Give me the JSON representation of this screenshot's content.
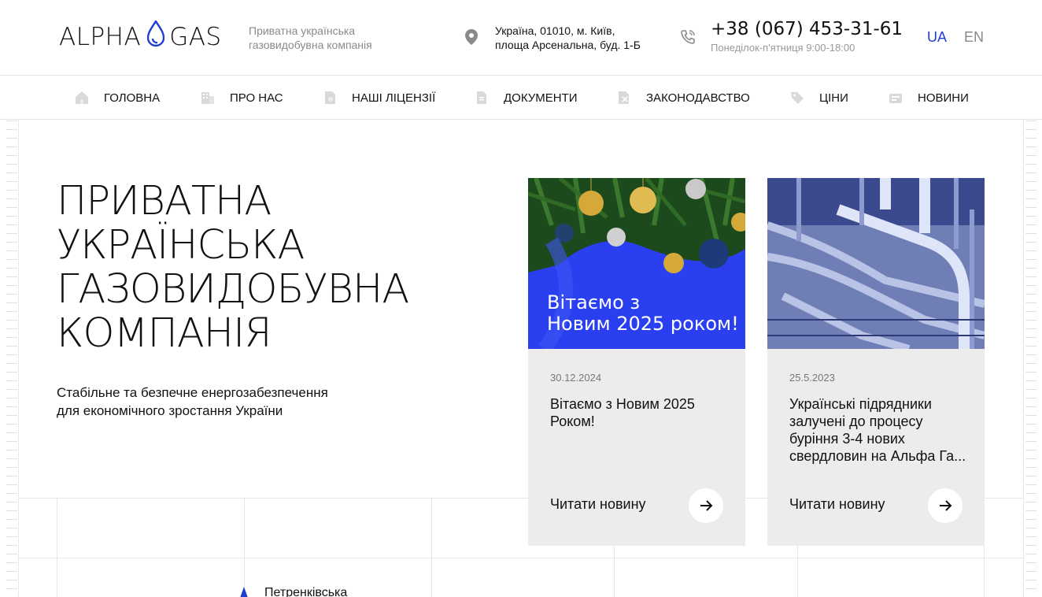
{
  "header": {
    "logo_left": "ALPHA",
    "logo_right": "GAS",
    "tagline_1": "Приватна українська",
    "tagline_2": "газовидобувна компанія",
    "address_1": "Україна, 01010, м. Київ,",
    "address_2": "площа Арсенальна, буд. 1-Б",
    "phone": "+38 (067) 453-31-61",
    "hours": "Понеділок-п'ятниця 9:00-18:00",
    "lang_ua": "UA",
    "lang_en": "EN"
  },
  "nav": {
    "items": [
      {
        "label": "ГОЛОВНА",
        "icon": "home-icon"
      },
      {
        "label": "ПРО НАС",
        "icon": "building-icon"
      },
      {
        "label": "НАШІ ЛІЦЕНЗІЇ",
        "icon": "license-icon"
      },
      {
        "label": "ДОКУМЕНТИ",
        "icon": "document-icon"
      },
      {
        "label": "ЗАКОНОДАВСТВО",
        "icon": "law-icon"
      },
      {
        "label": "ЦІНИ",
        "icon": "price-tag-icon"
      },
      {
        "label": "НОВИНИ",
        "icon": "news-icon"
      }
    ]
  },
  "hero": {
    "title_lines": [
      "ПРИВАТНА",
      "УКРАЇНСЬКА",
      "ГАЗОВИДОБУВНА",
      "КОМПАНІЯ"
    ],
    "subtitle_1": "Стабільне та безпечне енергозабезпечення",
    "subtitle_2": "для економічного зростання України"
  },
  "news": [
    {
      "image_caption_1": "Вітаємо з",
      "image_caption_2": "Новим 2025 роком!",
      "date": "30.12.2024",
      "title": "Вітаємо з Новим 2025 Роком!",
      "read_more": "Читати новину"
    },
    {
      "date": "25.5.2023",
      "title": "Українські підрядники залучені до процесу буріння 3-4 нових свердловин на Альфа Га...",
      "read_more": "Читати новину"
    }
  ],
  "map": {
    "label": "Петренківська"
  },
  "colors": {
    "accent": "#1f3fd0",
    "card_bg": "#ececec",
    "holiday_bg": "#2a3ff0"
  }
}
